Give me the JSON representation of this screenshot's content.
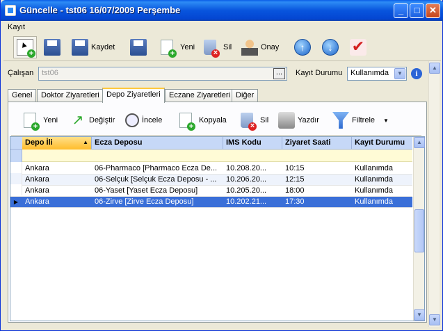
{
  "window": {
    "title": "Güncelle - tst06 16/07/2009 Perşembe",
    "minimize": "_",
    "maximize": "□",
    "close": "✕"
  },
  "menu": {
    "kayit": "Kayıt"
  },
  "toolbar": {
    "save_label": "Kaydet",
    "new_label": "Yeni",
    "delete_label": "Sil",
    "approve_label": "Onay"
  },
  "form": {
    "employee_label": "Çalışan",
    "employee_value": "tst06",
    "dots": "...",
    "status_label": "Kayıt Durumu",
    "status_value": "Kullanımda",
    "info": "i"
  },
  "tabs": [
    {
      "label": "Genel"
    },
    {
      "label": "Doktor Ziyaretleri"
    },
    {
      "label": "Depo Ziyaretleri"
    },
    {
      "label": "Eczane Ziyaretleri"
    },
    {
      "label": "Diğer"
    }
  ],
  "subtoolbar": {
    "new": "Yeni",
    "change": "Değiştir",
    "inspect": "İncele",
    "copy": "Kopyala",
    "delete": "Sil",
    "print": "Yazdır",
    "filter": "Filtrele"
  },
  "grid": {
    "columns": [
      "Depo İli",
      "Ecza Deposu",
      "IMS Kodu",
      "Ziyaret Saati",
      "Kayıt Durumu"
    ],
    "rows": [
      [
        "Ankara",
        "06-Pharmaco [Pharmaco Ecza De...",
        "10.208.20...",
        "10:15",
        "Kullanımda"
      ],
      [
        "Ankara",
        "06-Selçuk [Selçuk Ecza Deposu - ...",
        "10.206.20...",
        "12:15",
        "Kullanımda"
      ],
      [
        "Ankara",
        "06-Yaset [Yaset Ecza Deposu]",
        "10.205.20...",
        "18:00",
        "Kullanımda"
      ],
      [
        "Ankara",
        "06-Zirve [Zirve Ecza Deposu]",
        "10.202.21...",
        "17:30",
        "Kullanımda"
      ]
    ],
    "selected_row": 3
  }
}
